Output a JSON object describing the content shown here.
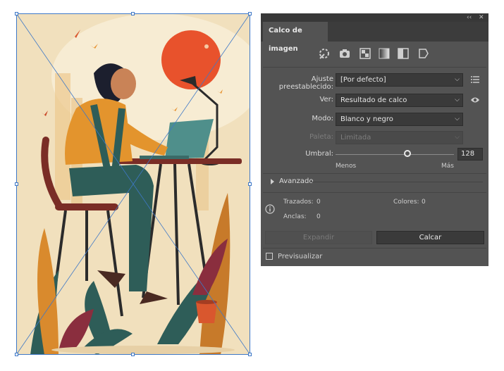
{
  "panel": {
    "title": "Calco de imagen",
    "topbar": {
      "collapse": "‹‹",
      "close": "✕"
    },
    "preset_icons": [
      "auto-color-icon",
      "high-color-icon",
      "low-color-icon",
      "grayscale-icon",
      "black-white-icon",
      "outline-icon"
    ],
    "preset": {
      "label": "Ajuste preestablecido:",
      "value": "[Por defecto]"
    },
    "view": {
      "label": "Ver:",
      "value": "Resultado de calco"
    },
    "mode": {
      "label": "Modo:",
      "value": "Blanco y negro"
    },
    "palette": {
      "label": "Paleta:",
      "value": "Limitada"
    },
    "threshold": {
      "label": "Umbral:",
      "value": "128",
      "less": "Menos",
      "more": "Más",
      "level": 0.61
    },
    "advanced": {
      "label": "Avanzado"
    },
    "info": {
      "paths_label": "Trazados:",
      "paths_value": "0",
      "colors_label": "Colores:",
      "colors_value": "0",
      "anchors_label": "Anclas:",
      "anchors_value": "0"
    },
    "buttons": {
      "expand": "Expandir",
      "trace": "Calcar"
    },
    "preview": {
      "label": "Previsualizar",
      "checked": false
    }
  },
  "colors": {
    "panel_bg": "#535353",
    "artboard_bg": "#f1e0bd",
    "selection": "#3e78c7",
    "sun": "#e8522c"
  }
}
